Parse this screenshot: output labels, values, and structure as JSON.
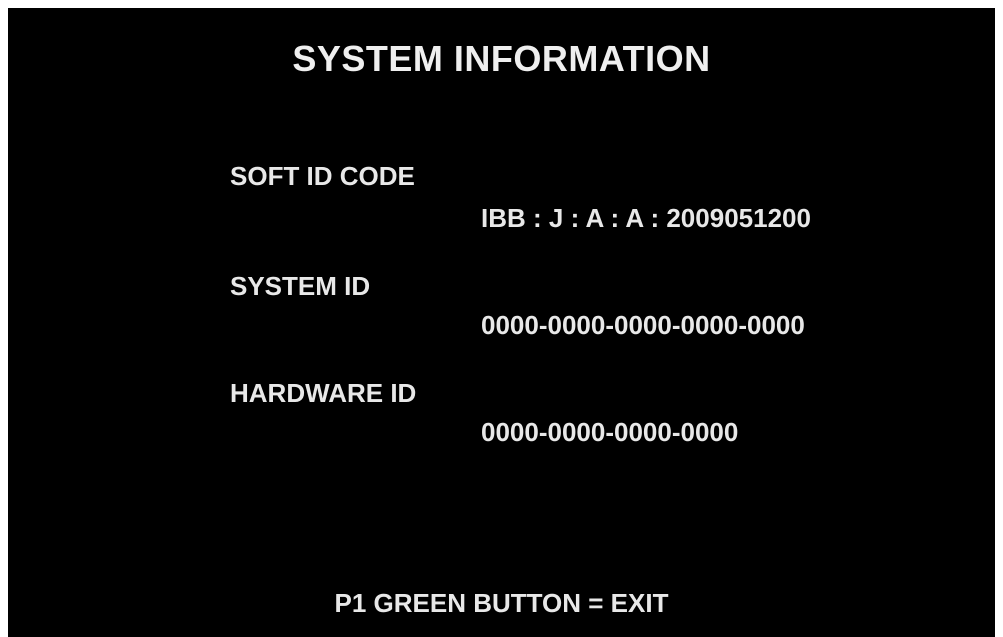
{
  "screen": {
    "title": "SYSTEM INFORMATION",
    "soft_id": {
      "label": "SOFT ID CODE",
      "value": "IBB : J : A : A : 2009051200"
    },
    "system_id": {
      "label": "SYSTEM ID",
      "value": "0000-0000-0000-0000-0000"
    },
    "hardware_id": {
      "label": "HARDWARE ID",
      "value": "0000-0000-0000-0000"
    },
    "footer": "P1 GREEN BUTTON = EXIT"
  },
  "colors": {
    "background": "#000000",
    "text": "#eeeeee",
    "border": "#ffffff"
  }
}
